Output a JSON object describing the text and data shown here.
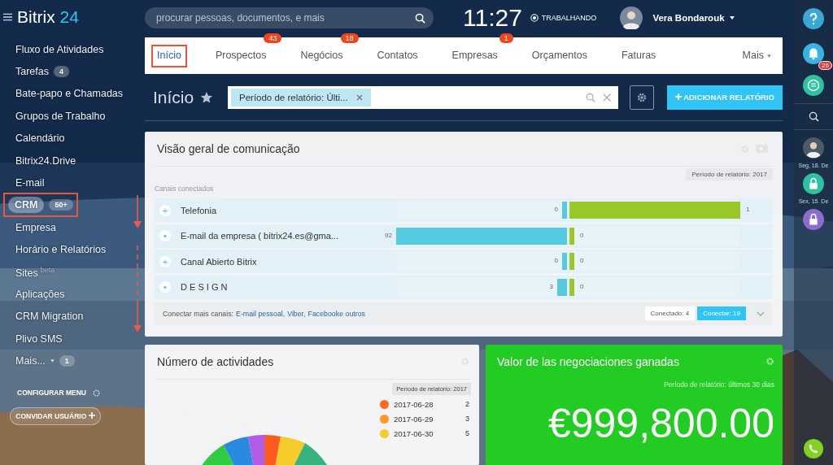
{
  "logo": {
    "name": "Bitrix",
    "suffix": "24"
  },
  "search": {
    "placeholder": "procurar pessoas, documentos, e mais"
  },
  "clock": {
    "time": "11:27",
    "status": "TRABALHANDO"
  },
  "user": {
    "name": "Vera Bondarouk"
  },
  "sidebar": {
    "items": [
      {
        "label": "Fluxo de Atividades",
        "highlighted": false
      },
      {
        "label": "Tarefas",
        "counter": "4",
        "highlighted": false
      },
      {
        "label": "Bate-papo e Chamadas",
        "highlighted": false
      },
      {
        "label": "Grupos de Trabalho",
        "highlighted": false
      },
      {
        "label": "Calendário",
        "highlighted": false
      },
      {
        "label": "Bitrix24.Drive",
        "highlighted": false
      },
      {
        "label": "E-mail",
        "highlighted": false
      },
      {
        "label": "CRM",
        "counter": "50+",
        "highlighted": true
      },
      {
        "label": "Empresa",
        "highlighted": false
      },
      {
        "label": "Horário e Relatórios",
        "highlighted": false
      },
      {
        "label": "Sites",
        "note": "beta",
        "highlighted": false
      },
      {
        "label": "Aplicações",
        "highlighted": false
      },
      {
        "label": "CRM Migration",
        "highlighted": false
      },
      {
        "label": "Plivo SMS",
        "highlighted": false
      },
      {
        "label": "Mais...",
        "counter": "1",
        "dropdown": true,
        "highlighted": false
      }
    ],
    "configure": "CONFIGURAR MENU",
    "invite": "CONVIDAR USUÁRIO"
  },
  "tabs": [
    {
      "label": "Início",
      "selected": true,
      "highlighted": true
    },
    {
      "label": "Prospectos",
      "badge": "43",
      "selected": false,
      "highlighted": false
    },
    {
      "label": "Negócios",
      "badge": "18",
      "selected": false,
      "highlighted": false
    },
    {
      "label": "Contatos",
      "selected": false,
      "highlighted": false
    },
    {
      "label": "Empresas",
      "badge": "1",
      "selected": false,
      "highlighted": false
    },
    {
      "label": "Orçamentos",
      "selected": false,
      "highlighted": false
    },
    {
      "label": "Faturas",
      "selected": false,
      "highlighted": false
    }
  ],
  "more_tab": "Mais",
  "page_title": "Início",
  "filter": {
    "tag": "Período de relatório: Últi..."
  },
  "add_report": "ADICIONAR RELATÓRIO",
  "communication": {
    "title": "Visão geral de comunicação",
    "period": "Período de relatório: 2017",
    "section": "Canais conectados",
    "channels": [
      {
        "expander": "+",
        "name": "Telefonia",
        "incoming": {
          "count": "0",
          "level": 0
        },
        "outgoing": {
          "count": "1",
          "level": 1
        }
      },
      {
        "expander": "•",
        "name": "E-mail da empresa ( bitrix24.es@gma...",
        "incoming": {
          "count": "92",
          "level": 1
        },
        "outgoing": {
          "count": "0",
          "level": 0
        }
      },
      {
        "expander": "+",
        "name": "Canal Abierto Bitrix",
        "incoming": {
          "count": "0",
          "level": 0
        },
        "outgoing": {
          "count": "0",
          "level": 0
        }
      },
      {
        "expander": "•",
        "name": "D E S I G N",
        "incoming": {
          "count": "3",
          "level": 0.03
        },
        "outgoing": {
          "count": "0",
          "level": 0
        }
      }
    ],
    "footer_label": "Conectar mais canais:",
    "footer_links": [
      "E-mail pessoal,",
      "Viber,",
      "Facebooke outros"
    ],
    "connected": "Conectado: 4",
    "connect": "Conectar: 19"
  },
  "activities": {
    "title": "Número de actividades",
    "period": "Período de relatório: 2017",
    "legend": [
      {
        "label": "2017-06-28",
        "count": "2",
        "color": "#ff6a1f"
      },
      {
        "label": "2017-06-29",
        "count": "3",
        "color": "#ff9a26"
      },
      {
        "label": "2017-06-30",
        "count": "5",
        "color": "#f5cc2c"
      }
    ]
  },
  "deals": {
    "title": "Valor de las negociaciones ganadas",
    "period": "Período de relatório: últimos 30 dias",
    "value": "€999,800.00"
  },
  "rightbar": {
    "notifications": "26",
    "dates": [
      "Seg, 18. De",
      "Sex, 15. De"
    ]
  }
}
